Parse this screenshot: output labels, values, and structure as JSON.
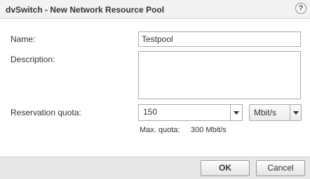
{
  "dialog": {
    "title": "dvSwitch - New Network Resource Pool",
    "help_glyph": "?"
  },
  "form": {
    "name_label": "Name:",
    "name_value": "Testpool",
    "description_label": "Description:",
    "description_value": "",
    "reservation_label": "Reservation quota:",
    "reservation_value": "150",
    "unit_value": "Mbit/s",
    "max_quota_label": "Max. quota:",
    "max_quota_value": "300 Mbit/s"
  },
  "footer": {
    "ok_label": "OK",
    "cancel_label": "Cancel"
  },
  "icons": {
    "help": "question-mark-icon",
    "dropdown": "chevron-down-icon"
  }
}
